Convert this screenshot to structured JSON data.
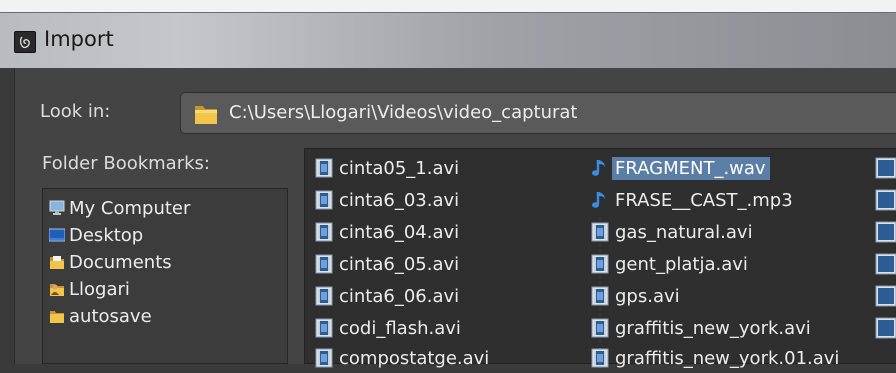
{
  "window": {
    "title": "Import"
  },
  "look_in": {
    "label": "Look in:",
    "path": "C:\\Users\\Llogari\\Videos\\video_capturat"
  },
  "bookmarks": {
    "label": "Folder Bookmarks:",
    "items": [
      {
        "label": "My Computer",
        "icon": "computer-icon"
      },
      {
        "label": "Desktop",
        "icon": "desktop-icon"
      },
      {
        "label": "Documents",
        "icon": "documents-folder-icon"
      },
      {
        "label": "Llogari",
        "icon": "user-folder-icon"
      },
      {
        "label": "autosave",
        "icon": "folder-icon"
      }
    ]
  },
  "files": {
    "column1": [
      {
        "name": "cinta05_1.avi",
        "icon": "video-file-icon"
      },
      {
        "name": "cinta6_03.avi",
        "icon": "video-file-icon"
      },
      {
        "name": "cinta6_04.avi",
        "icon": "video-file-icon"
      },
      {
        "name": "cinta6_05.avi",
        "icon": "video-file-icon"
      },
      {
        "name": "cinta6_06.avi",
        "icon": "video-file-icon"
      },
      {
        "name": "codi_flash.avi",
        "icon": "video-file-icon"
      },
      {
        "name": "compostatge.avi",
        "icon": "video-file-icon"
      }
    ],
    "column2": [
      {
        "name": "FRAGMENT_.wav",
        "icon": "audio-file-icon",
        "selected": true
      },
      {
        "name": "FRASE__CAST_.mp3",
        "icon": "audio-file-icon"
      },
      {
        "name": "gas_natural.avi",
        "icon": "video-file-icon"
      },
      {
        "name": "gent_platja.avi",
        "icon": "video-file-icon"
      },
      {
        "name": "gps.avi",
        "icon": "video-file-icon"
      },
      {
        "name": "graffitis_new_york.avi",
        "icon": "video-file-icon"
      },
      {
        "name": "graffitis_new_york.01.avi",
        "icon": "video-file-icon"
      }
    ]
  },
  "colors": {
    "selection": "#5b7ea6",
    "audio_icon": "#3a8ee6",
    "folder_icon": "#e8b93a"
  }
}
